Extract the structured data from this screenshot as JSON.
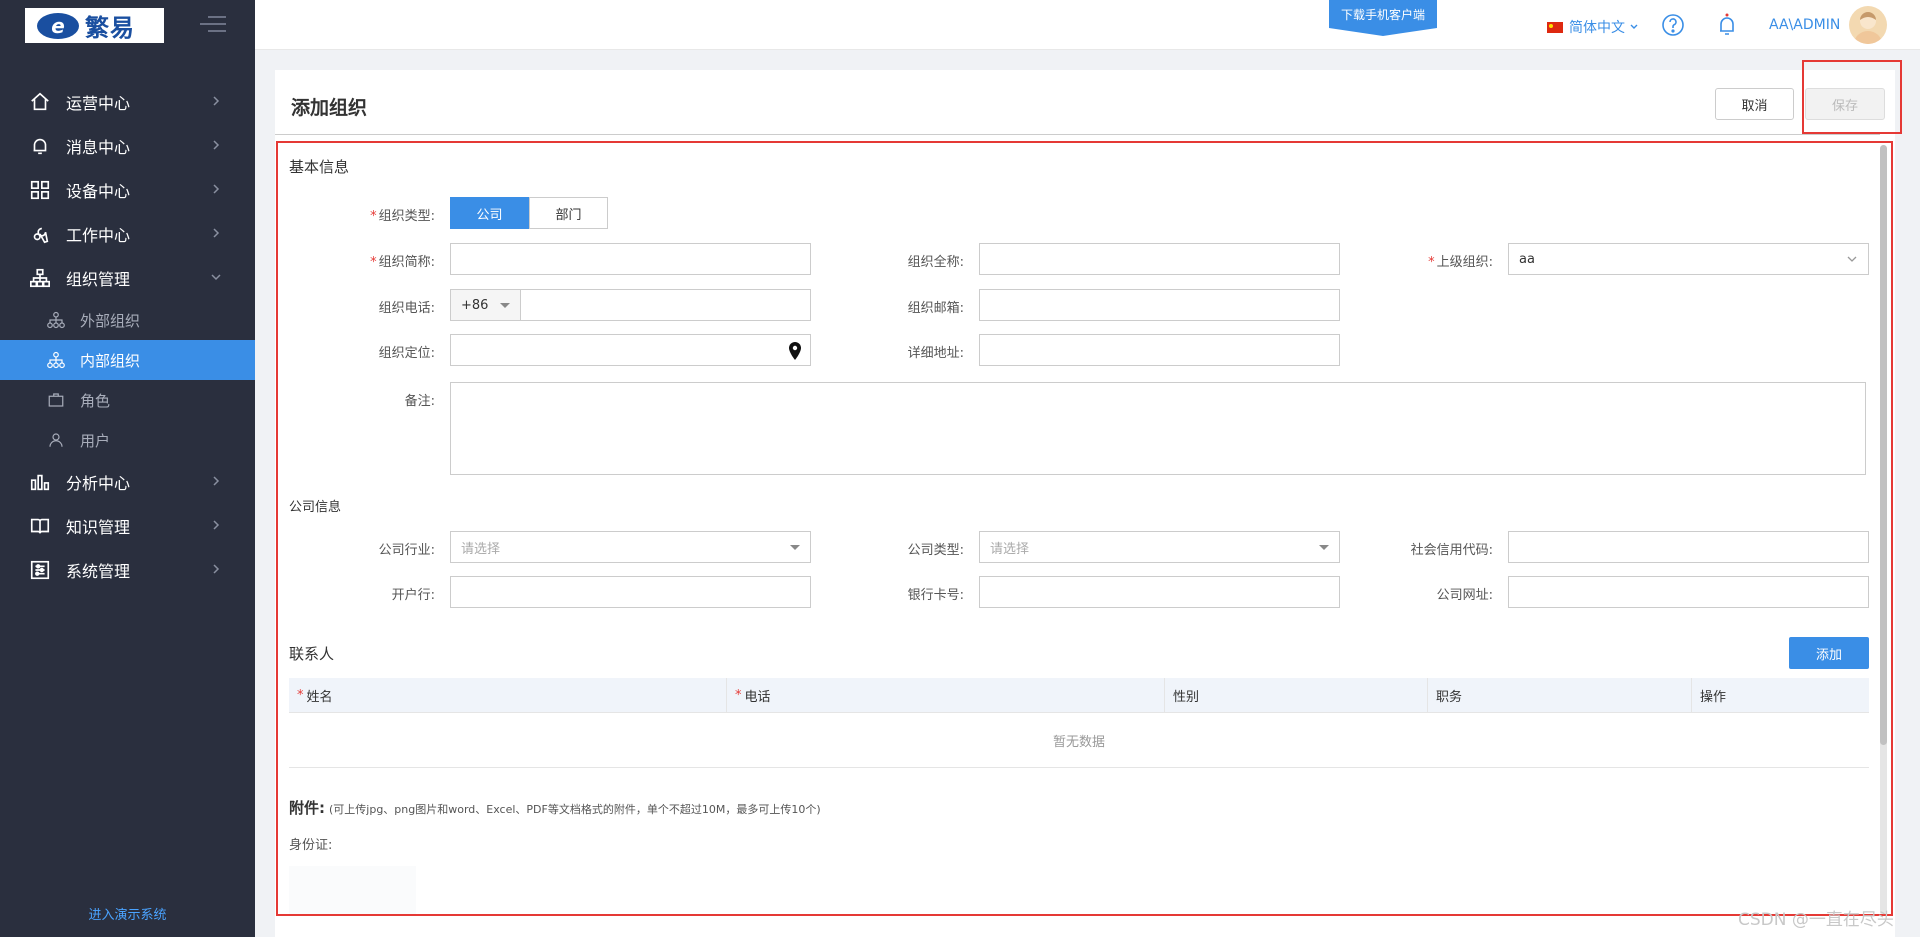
{
  "logo": {
    "mark": "e",
    "text": "繁易"
  },
  "menu": {
    "items": [
      {
        "label": "运营中心"
      },
      {
        "label": "消息中心"
      },
      {
        "label": "设备中心"
      },
      {
        "label": "工作中心"
      },
      {
        "label": "组织管理"
      },
      {
        "label": "分析中心"
      },
      {
        "label": "知识管理"
      },
      {
        "label": "系统管理"
      }
    ],
    "sub_items": [
      {
        "label": "外部组织"
      },
      {
        "label": "内部组织"
      },
      {
        "label": "角色"
      },
      {
        "label": "用户"
      }
    ],
    "demo_link": "进入演示系统"
  },
  "header": {
    "download_banner": "下载手机客户端",
    "language": "简体中文",
    "user": "AA\\ADMIN"
  },
  "page": {
    "title": "添加组织",
    "cancel": "取消",
    "save": "保存"
  },
  "form": {
    "basic_title": "基本信息",
    "org_type_label": "组织类型:",
    "org_type_options": [
      "公司",
      "部门"
    ],
    "short_name_label": "组织简称:",
    "full_name_label": "组织全称:",
    "parent_label": "上级组织:",
    "parent_value": "aa",
    "phone_label": "组织电话:",
    "phone_prefix": "+86",
    "email_label": "组织邮箱:",
    "location_label": "组织定位:",
    "address_label": "详细地址:",
    "remark_label": "备注:",
    "company_title": "公司信息",
    "industry_label": "公司行业:",
    "industry_placeholder": "请选择",
    "company_type_label": "公司类型:",
    "company_type_placeholder": "请选择",
    "credit_code_label": "社会信用代码:",
    "bank_label": "开户行:",
    "card_label": "银行卡号:",
    "website_label": "公司网址:"
  },
  "contacts": {
    "title": "联系人",
    "add": "添加",
    "columns": [
      "姓名",
      "电话",
      "性别",
      "职务",
      "操作"
    ],
    "empty": "暂无数据"
  },
  "attachments": {
    "title": "附件:",
    "hint": "(可上传jpg、png图片和word、Excel、PDF等文档格式的附件，单个不超过10M，最多可上传10个)",
    "id_label": "身份证:"
  },
  "watermark": "CSDN @一直在尽头",
  "colors": {
    "accent": "#3a8ee6",
    "sidebar": "#2a2f3e",
    "required": "#e53935",
    "highlight_box": "#e53935"
  }
}
